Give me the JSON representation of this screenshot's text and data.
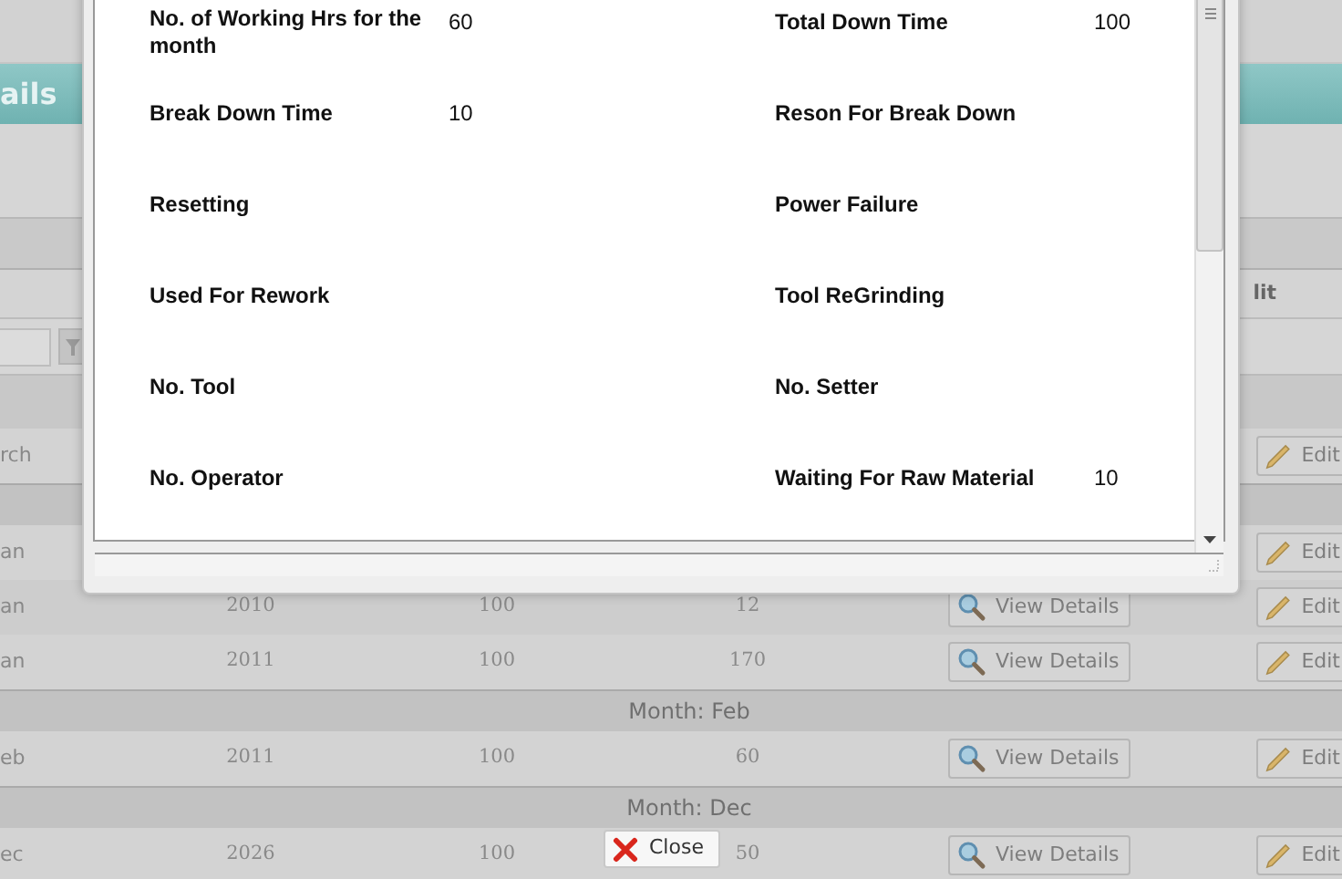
{
  "page": {
    "title": "ails",
    "header_cell": "lit",
    "rows": [
      {
        "kind": "search",
        "month": "rch",
        "edit": "Edit"
      },
      {
        "kind": "group"
      },
      {
        "kind": "data",
        "month": "an",
        "edit": "Edit"
      },
      {
        "kind": "data",
        "month": "an",
        "year": "2010",
        "target": "100",
        "value": "12",
        "view": "View Details",
        "edit": "Edit"
      },
      {
        "kind": "data",
        "month": "an",
        "year": "2011",
        "target": "100",
        "value": "170",
        "view": "View Details",
        "edit": "Edit"
      },
      {
        "kind": "group",
        "label": "Month: Feb"
      },
      {
        "kind": "data",
        "month": "eb",
        "year": "2011",
        "target": "100",
        "value": "60",
        "view": "View Details",
        "edit": "Edit"
      },
      {
        "kind": "group",
        "label": "Month: Dec"
      },
      {
        "kind": "data",
        "month": "ec",
        "year": "2026",
        "target": "100",
        "value": "50",
        "view": "View Details",
        "edit": "Edit"
      }
    ]
  },
  "dialog": {
    "fields": [
      {
        "label": "No. of Working Hrs for the month",
        "value": "60"
      },
      {
        "label": "Total Down Time",
        "value": "100"
      },
      {
        "label": "Break Down Time",
        "value": "10"
      },
      {
        "label": "Reson For Break Down"
      },
      {
        "label": "Resetting"
      },
      {
        "label": "Power Failure"
      },
      {
        "label": "Used For Rework"
      },
      {
        "label": "Tool ReGrinding"
      },
      {
        "label": "No. Tool"
      },
      {
        "label": "No. Setter"
      },
      {
        "label": "No. Operator"
      },
      {
        "label": "Waiting For Raw Material",
        "value": "10"
      }
    ],
    "close_button": "Close"
  }
}
